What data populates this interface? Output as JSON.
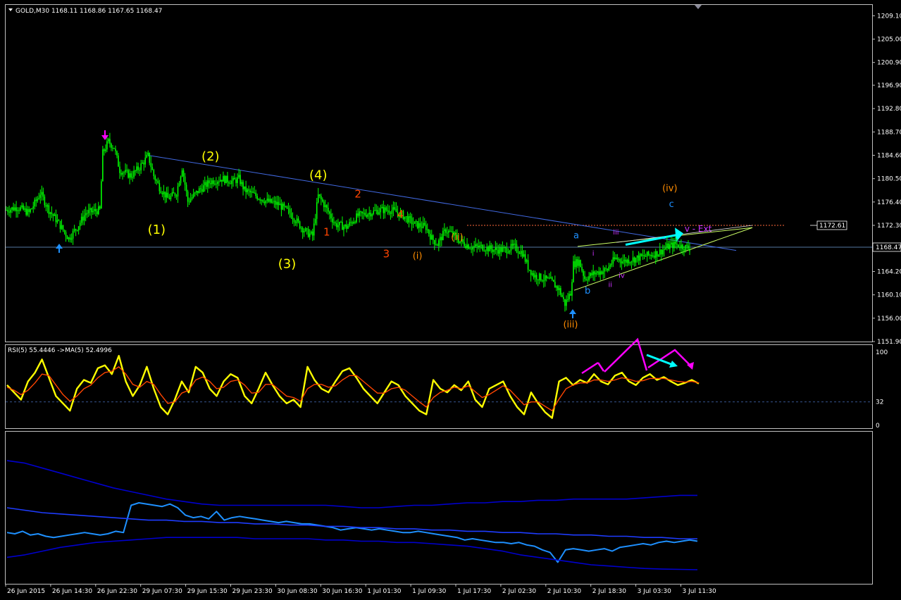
{
  "header": {
    "main_title": "GOLD,M30  1168.11 1168.86 1167.65 1168.47",
    "rsi_title": "RSI(5) 55.4446  ->MA(5) 52.4996"
  },
  "colors": {
    "background": "#000000",
    "candle": "#00ff00",
    "frame": "#c0c0c0",
    "rsi": "#ffff00",
    "rsi_ma": "#ff4500",
    "band": "#0000cd",
    "band_mid": "#1e3cff",
    "indicator_line": "#1e90ff",
    "trendline": "#4169e1",
    "triangle": "#ccff66",
    "magenta": "#ff00ff",
    "cyan": "#00ffff",
    "wave_yellow": "#ffff00",
    "wave_red": "#ff4500",
    "wave_orange": "#ff8c00",
    "wave_blue": "#1e90ff",
    "wave_purple": "#cc33ff"
  },
  "chart_data": [
    {
      "type": "candlestick",
      "symbol": "GOLD",
      "timeframe": "M30",
      "title": "GOLD,M30",
      "ohlc_last": {
        "open": 1168.11,
        "high": 1168.86,
        "low": 1167.65,
        "close": 1168.47
      },
      "current_price": 1168.47,
      "marked_level": 1172.61,
      "ylim": [
        1151.9,
        1211.0
      ],
      "y_ticks": [
        1209.1,
        1205.0,
        1200.9,
        1196.9,
        1192.8,
        1188.7,
        1184.6,
        1180.5,
        1176.4,
        1172.3,
        1168.3,
        1164.2,
        1160.1,
        1156.0,
        1151.9
      ],
      "x_labels": [
        "26 Jun 2015",
        "26 Jun 14:30",
        "26 Jun 22:30",
        "29 Jun 07:30",
        "29 Jun 15:30",
        "29 Jun 23:30",
        "30 Jun 08:30",
        "30 Jun 16:30",
        "1 Jul 01:30",
        "1 Jul 09:30",
        "1 Jul 17:30",
        "2 Jul 02:30",
        "2 Jul 10:30",
        "2 Jul 18:30",
        "3 Jul 03:30",
        "3 Jul 11:30"
      ],
      "path": [
        [
          0,
          1175
        ],
        [
          2,
          1175.5
        ],
        [
          4,
          1174.5
        ],
        [
          5.5,
          1177
        ],
        [
          6,
          1178
        ],
        [
          7.5,
          1175
        ],
        [
          9,
          1173
        ],
        [
          11,
          1170
        ],
        [
          12.5,
          1172
        ],
        [
          14,
          1174.5
        ],
        [
          16.5,
          1175
        ],
        [
          17,
          1185
        ],
        [
          18,
          1187
        ],
        [
          19,
          1186
        ],
        [
          20,
          1182
        ],
        [
          22,
          1181
        ],
        [
          23.5,
          1182.5
        ],
        [
          25,
          1184.5
        ],
        [
          26,
          1181
        ],
        [
          27,
          1179
        ],
        [
          28.5,
          1177
        ],
        [
          30,
          1178
        ],
        [
          31,
          1182.5
        ],
        [
          32,
          1176.5
        ],
        [
          34,
          1178.5
        ],
        [
          36,
          1180
        ],
        [
          38,
          1180.5
        ],
        [
          40,
          1180
        ],
        [
          41,
          1180.5
        ],
        [
          42,
          1178.5
        ],
        [
          44,
          1177.5
        ],
        [
          46,
          1176.5
        ],
        [
          48,
          1176
        ],
        [
          50,
          1174.5
        ],
        [
          52,
          1172
        ],
        [
          53,
          1171
        ],
        [
          54,
          1170.5
        ],
        [
          55,
          1177.5
        ],
        [
          56,
          1176
        ],
        [
          58,
          1172.5
        ],
        [
          60,
          1172
        ],
        [
          62,
          1174
        ],
        [
          64,
          1174.5
        ],
        [
          66,
          1175
        ],
        [
          68,
          1175
        ],
        [
          70,
          1174
        ],
        [
          72,
          1172.5
        ],
        [
          74,
          1172
        ],
        [
          75,
          1170
        ],
        [
          76,
          1169
        ],
        [
          77.5,
          1171.5
        ],
        [
          79,
          1170.5
        ],
        [
          80,
          1169.5
        ],
        [
          82,
          1168.5
        ],
        [
          84,
          1168.5
        ],
        [
          86,
          1168
        ],
        [
          88,
          1168
        ],
        [
          89.5,
          1168.5
        ],
        [
          91,
          1167.5
        ],
        [
          92,
          1165
        ],
        [
          93,
          1163.5
        ],
        [
          94.5,
          1163
        ],
        [
          96,
          1162.5
        ],
        [
          97.5,
          1161
        ],
        [
          98.5,
          1158.5
        ],
        [
          99.5,
          1160.5
        ],
        [
          100,
          1165.5
        ],
        [
          101,
          1166
        ],
        [
          102,
          1163
        ],
        [
          104,
          1164
        ],
        [
          106,
          1164.5
        ],
        [
          106.5,
          1165.5
        ],
        [
          107.5,
          1166.5
        ],
        [
          109,
          1166
        ],
        [
          111,
          1166.5
        ],
        [
          113,
          1167
        ],
        [
          115,
          1167.5
        ],
        [
          116.5,
          1168.5
        ],
        [
          118,
          1169
        ],
        [
          119.5,
          1168.5
        ],
        [
          120.5,
          1168.3
        ]
      ]
    },
    {
      "type": "line",
      "title": "RSI(5) 55.4446  ->MA(5) 52.4996",
      "ylim": [
        0,
        100
      ],
      "y_ticks": [
        100,
        32,
        0
      ],
      "level": 32,
      "series": [
        {
          "name": "RSI(5)",
          "values": [
            55,
            45,
            35,
            60,
            72,
            90,
            65,
            40,
            30,
            20,
            50,
            62,
            58,
            78,
            82,
            70,
            95,
            60,
            40,
            55,
            80,
            50,
            25,
            15,
            35,
            60,
            45,
            80,
            72,
            50,
            40,
            60,
            70,
            65,
            40,
            30,
            50,
            72,
            55,
            40,
            30,
            35,
            25,
            80,
            62,
            50,
            45,
            60,
            74,
            78,
            65,
            50,
            40,
            30,
            45,
            60,
            55,
            40,
            30,
            20,
            15,
            62,
            50,
            45,
            55,
            48,
            60,
            35,
            25,
            50,
            55,
            60,
            40,
            25,
            15,
            45,
            30,
            18,
            10,
            60,
            65,
            55,
            62,
            58,
            70,
            60,
            56,
            68,
            72,
            60,
            55,
            65,
            70,
            62,
            66,
            60,
            55,
            58,
            62,
            57
          ]
        },
        {
          "name": "MA(5)",
          "values": [
            52,
            48,
            42,
            48,
            58,
            70,
            68,
            55,
            42,
            33,
            40,
            50,
            55,
            65,
            72,
            74,
            80,
            70,
            56,
            52,
            60,
            56,
            42,
            30,
            32,
            44,
            48,
            62,
            66,
            60,
            50,
            52,
            60,
            62,
            55,
            44,
            45,
            56,
            56,
            48,
            40,
            38,
            33,
            50,
            56,
            56,
            52,
            54,
            62,
            68,
            68,
            60,
            52,
            44,
            44,
            50,
            52,
            48,
            40,
            32,
            25,
            38,
            45,
            48,
            52,
            50,
            54,
            46,
            38,
            42,
            48,
            54,
            48,
            38,
            28,
            32,
            32,
            26,
            20,
            36,
            50,
            55,
            58,
            58,
            62,
            62,
            60,
            62,
            65,
            63,
            60,
            61,
            64,
            64,
            64,
            62,
            60,
            59,
            60,
            58
          ]
        }
      ]
    },
    {
      "type": "line",
      "title": "",
      "series": [
        {
          "values": [
            30,
            29,
            31,
            28,
            29,
            27,
            26,
            27,
            28,
            29,
            30,
            29,
            28,
            29,
            31,
            30,
            52,
            54,
            53,
            52,
            51,
            53,
            50,
            44,
            42,
            43,
            41,
            47,
            40,
            42,
            43,
            42,
            41,
            40,
            39,
            38,
            39,
            38,
            37,
            37,
            36,
            35,
            34,
            32,
            33,
            34,
            33,
            32,
            33,
            32,
            31,
            30,
            30,
            31,
            30,
            29,
            28,
            27,
            26,
            24,
            25,
            24,
            23,
            22,
            22,
            21,
            22,
            20,
            19,
            16,
            14,
            6,
            16,
            17,
            16,
            15,
            16,
            17,
            15,
            18,
            19,
            20,
            21,
            20,
            22,
            23,
            22,
            23,
            24,
            23
          ]
        },
        {
          "values": [
            88,
            86,
            82,
            78,
            74,
            70,
            66,
            63,
            60,
            57,
            55,
            53,
            52,
            52,
            52,
            52,
            52,
            52,
            52,
            51,
            50,
            50,
            51,
            52,
            52,
            53,
            54,
            54,
            55,
            55,
            56,
            56,
            57,
            57,
            57,
            57,
            58,
            59,
            60,
            60
          ]
        },
        {
          "values": [
            50,
            48,
            46,
            45,
            44,
            43,
            42,
            41,
            40,
            40,
            39,
            39,
            38,
            38,
            37,
            37,
            36,
            36,
            35,
            35,
            34,
            34,
            33,
            33,
            32,
            32,
            31,
            31,
            30,
            30,
            29,
            29,
            28,
            28,
            27,
            27,
            26,
            26,
            25,
            25
          ]
        },
        {
          "values": [
            10,
            12,
            15,
            18,
            20,
            22,
            23,
            24,
            25,
            26,
            26,
            26,
            26,
            26,
            25,
            25,
            25,
            25,
            24,
            24,
            23,
            23,
            22,
            22,
            21,
            20,
            19,
            17,
            15,
            12,
            10,
            8,
            6,
            4,
            3,
            2,
            1,
            0.5,
            0.3,
            0
          ]
        }
      ]
    }
  ],
  "wave_labels": [
    {
      "text": "(1)",
      "x": 26.5,
      "price": 1170.8,
      "color": "wave_yellow",
      "size": 18
    },
    {
      "text": "(2)",
      "x": 36,
      "price": 1183.7,
      "color": "wave_yellow",
      "size": 18
    },
    {
      "text": "(3)",
      "x": 49.5,
      "price": 1164.8,
      "color": "wave_yellow",
      "size": 18
    },
    {
      "text": "(4)",
      "x": 55,
      "price": 1180.4,
      "color": "wave_yellow",
      "size": 18
    },
    {
      "text": "1",
      "x": 56.5,
      "price": 1170.5,
      "color": "wave_red",
      "size": 15
    },
    {
      "text": "2",
      "x": 62,
      "price": 1177.2,
      "color": "wave_red",
      "size": 15
    },
    {
      "text": "3",
      "x": 67,
      "price": 1166.7,
      "color": "wave_red",
      "size": 15
    },
    {
      "text": "4",
      "x": 69.5,
      "price": 1173.6,
      "color": "wave_red",
      "size": 15
    },
    {
      "text": "(i)",
      "x": 72.5,
      "price": 1166.4,
      "color": "wave_orange",
      "size": 13
    },
    {
      "text": "(ii)",
      "x": 79.5,
      "price": 1169.7,
      "color": "wave_orange",
      "size": 13
    },
    {
      "text": "(iii)",
      "x": 99.5,
      "price": 1154.4,
      "color": "wave_orange",
      "size": 13
    },
    {
      "text": "(iv)",
      "x": 117,
      "price": 1178.3,
      "color": "wave_orange",
      "size": 13
    },
    {
      "text": "a",
      "x": 100.5,
      "price": 1170.0,
      "color": "wave_blue",
      "size": 13
    },
    {
      "text": "b",
      "x": 102.5,
      "price": 1160.3,
      "color": "wave_blue",
      "size": 13
    },
    {
      "text": "c",
      "x": 117.3,
      "price": 1175.5,
      "color": "wave_blue",
      "size": 13
    },
    {
      "text": "i",
      "x": 103.5,
      "price": 1167.0,
      "color": "wave_purple",
      "size": 10
    },
    {
      "text": "ii",
      "x": 106.5,
      "price": 1161.5,
      "color": "wave_purple",
      "size": 10
    },
    {
      "text": "iii",
      "x": 107.5,
      "price": 1170.7,
      "color": "wave_purple",
      "size": 10
    },
    {
      "text": "iv",
      "x": 108.5,
      "price": 1163.1,
      "color": "wave_purple",
      "size": 10
    },
    {
      "text": "v - Ext",
      "x": 122,
      "price": 1171.2,
      "color": "wave_purple",
      "size": 12
    }
  ]
}
